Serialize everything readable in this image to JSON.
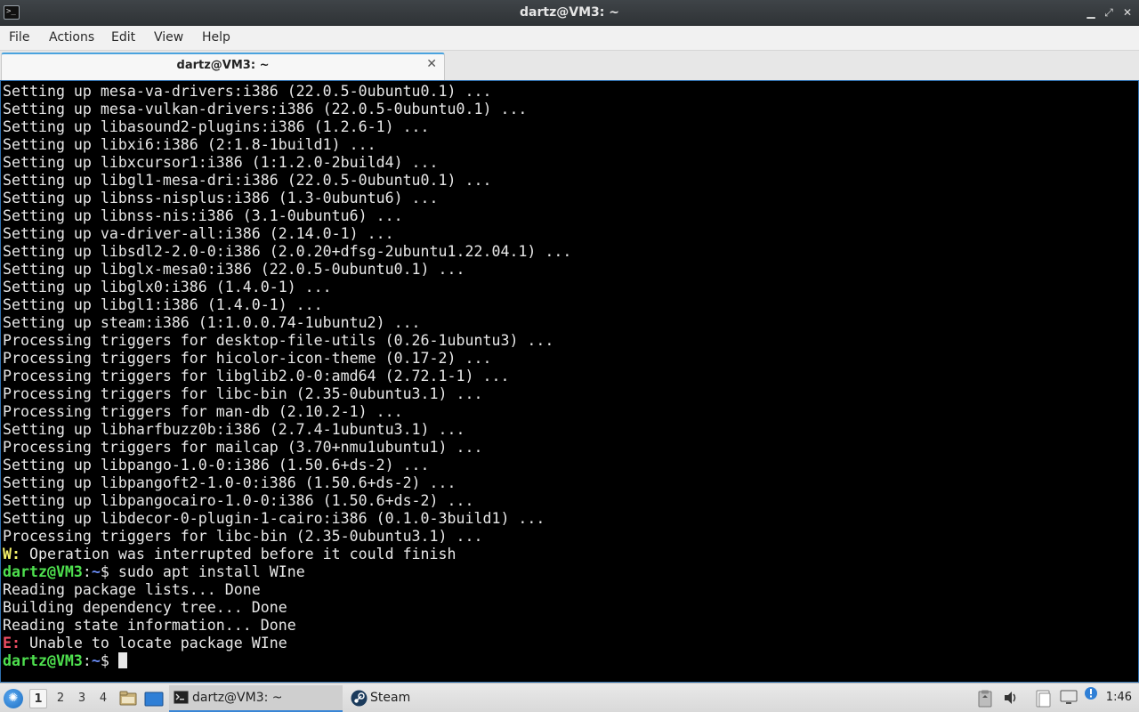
{
  "window": {
    "title": "dartz@VM3: ~",
    "minimize": "▁",
    "maximize": "⤢",
    "close": "✕"
  },
  "menu": [
    "File",
    "Actions",
    "Edit",
    "View",
    "Help"
  ],
  "tab": {
    "label": "dartz@VM3: ~",
    "close": "✕"
  },
  "terminal": {
    "lines": [
      [
        {
          "t": "Setting up mesa-va-drivers:i386 (22.0.5-0ubuntu0.1) ..."
        }
      ],
      [
        {
          "t": "Setting up mesa-vulkan-drivers:i386 (22.0.5-0ubuntu0.1) ..."
        }
      ],
      [
        {
          "t": "Setting up libasound2-plugins:i386 (1.2.6-1) ..."
        }
      ],
      [
        {
          "t": "Setting up libxi6:i386 (2:1.8-1build1) ..."
        }
      ],
      [
        {
          "t": "Setting up libxcursor1:i386 (1:1.2.0-2build4) ..."
        }
      ],
      [
        {
          "t": "Setting up libgl1-mesa-dri:i386 (22.0.5-0ubuntu0.1) ..."
        }
      ],
      [
        {
          "t": "Setting up libnss-nisplus:i386 (1.3-0ubuntu6) ..."
        }
      ],
      [
        {
          "t": "Setting up libnss-nis:i386 (3.1-0ubuntu6) ..."
        }
      ],
      [
        {
          "t": "Setting up va-driver-all:i386 (2.14.0-1) ..."
        }
      ],
      [
        {
          "t": "Setting up libsdl2-2.0-0:i386 (2.0.20+dfsg-2ubuntu1.22.04.1) ..."
        }
      ],
      [
        {
          "t": "Setting up libglx-mesa0:i386 (22.0.5-0ubuntu0.1) ..."
        }
      ],
      [
        {
          "t": "Setting up libglx0:i386 (1.4.0-1) ..."
        }
      ],
      [
        {
          "t": "Setting up libgl1:i386 (1.4.0-1) ..."
        }
      ],
      [
        {
          "t": "Setting up steam:i386 (1:1.0.0.74-1ubuntu2) ..."
        }
      ],
      [
        {
          "t": "Processing triggers for desktop-file-utils (0.26-1ubuntu3) ..."
        }
      ],
      [
        {
          "t": "Processing triggers for hicolor-icon-theme (0.17-2) ..."
        }
      ],
      [
        {
          "t": "Processing triggers for libglib2.0-0:amd64 (2.72.1-1) ..."
        }
      ],
      [
        {
          "t": "Processing triggers for libc-bin (2.35-0ubuntu3.1) ..."
        }
      ],
      [
        {
          "t": "Processing triggers for man-db (2.10.2-1) ..."
        }
      ],
      [
        {
          "t": "Setting up libharfbuzz0b:i386 (2.7.4-1ubuntu3.1) ..."
        }
      ],
      [
        {
          "t": "Processing triggers for mailcap (3.70+nmu1ubuntu1) ..."
        }
      ],
      [
        {
          "t": "Setting up libpango-1.0-0:i386 (1.50.6+ds-2) ..."
        }
      ],
      [
        {
          "t": "Setting up libpangoft2-1.0-0:i386 (1.50.6+ds-2) ..."
        }
      ],
      [
        {
          "t": "Setting up libpangocairo-1.0-0:i386 (1.50.6+ds-2) ..."
        }
      ],
      [
        {
          "t": "Setting up libdecor-0-plugin-1-cairo:i386 (0.1.0-3build1) ..."
        }
      ],
      [
        {
          "t": "Processing triggers for libc-bin (2.35-0ubuntu3.1) ..."
        }
      ],
      [
        {
          "t": "W:",
          "c": "yellow"
        },
        {
          "t": " Operation was interrupted before it could finish"
        }
      ],
      [
        {
          "t": "dartz@VM3",
          "c": "green"
        },
        {
          "t": ":"
        },
        {
          "t": "~",
          "c": "blue"
        },
        {
          "t": "$ sudo apt install WIne"
        }
      ],
      [
        {
          "t": "Reading package lists... Done"
        }
      ],
      [
        {
          "t": "Building dependency tree... Done"
        }
      ],
      [
        {
          "t": "Reading state information... Done"
        }
      ],
      [
        {
          "t": "E:",
          "c": "red"
        },
        {
          "t": " Unable to locate package WIne"
        }
      ],
      [
        {
          "t": "dartz@VM3",
          "c": "green"
        },
        {
          "t": ":"
        },
        {
          "t": "~",
          "c": "blue"
        },
        {
          "t": "$ "
        },
        {
          "cursor": true
        }
      ]
    ]
  },
  "taskbar": {
    "workspaces": [
      "1",
      "2",
      "3",
      "4"
    ],
    "tasks": [
      {
        "label": "dartz@VM3: ~",
        "icon": "terminal-icon",
        "active": true
      },
      {
        "label": "Steam",
        "icon": "steam-icon",
        "active": false
      }
    ],
    "tray_icons": [
      "clipboard-icon",
      "volume-icon",
      "files-icon",
      "network-icon",
      "update-notifier-icon"
    ],
    "clock": "1:46"
  },
  "colors": {
    "prompt_user": "#4ee04e",
    "prompt_path": "#6b8df7",
    "warning": "#f7f56b",
    "error": "#ef4d63",
    "terminal_bg": "#000000",
    "tab_accent": "#4aa3df"
  }
}
